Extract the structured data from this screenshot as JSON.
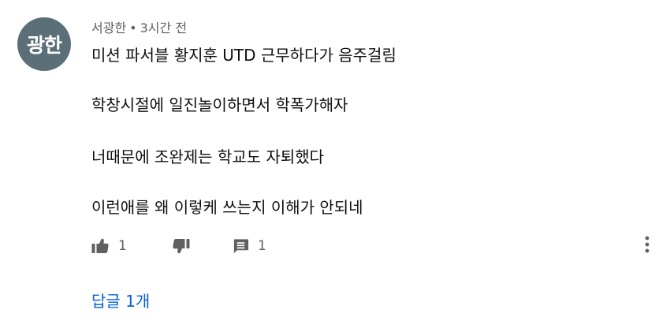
{
  "comment": {
    "avatar_text": "광한",
    "avatar_color": "#5b6f79",
    "author": "서광한",
    "separator": "•",
    "time": "3시간 전",
    "lines": [
      "미션 파서블 황지훈 UTD 근무하다가 음주걸림",
      "학창시절에 일진놀이하면서 학폭가해자",
      "너때문에 조완제는 학교도 자퇴했다",
      "이런애를 왜 이렇케 쓰는지 이해가 안되네"
    ],
    "actions": {
      "like_icon": "thumbs-up-icon",
      "like_count": "1",
      "dislike_icon": "thumbs-down-icon",
      "reply_icon": "comment-icon",
      "reply_count": "1",
      "more_icon": "more-vertical-icon"
    },
    "replies_label": "답글 1개",
    "link_color": "#065fd4"
  }
}
